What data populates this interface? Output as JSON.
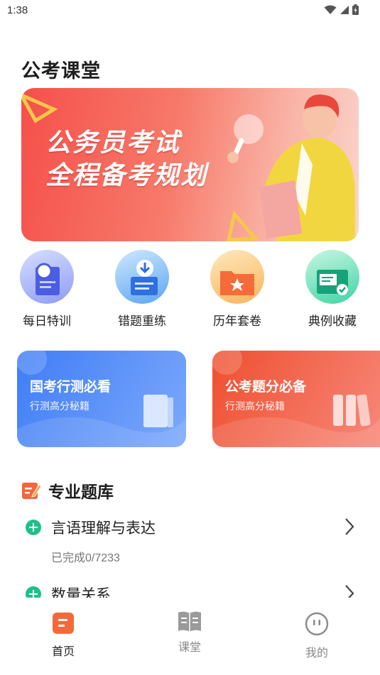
{
  "status_bar": {
    "time": "1:38"
  },
  "app_title": "公考课堂",
  "banner": {
    "line1": "公务员考试",
    "line2": "全程备考规划"
  },
  "quick_entries": [
    {
      "label": "每日特训",
      "icon": "daily-training-icon"
    },
    {
      "label": "错题重练",
      "icon": "wrong-questions-icon"
    },
    {
      "label": "历年套卷",
      "icon": "past-papers-icon"
    },
    {
      "label": "典例收藏",
      "icon": "favorites-icon"
    }
  ],
  "cards": [
    {
      "title": "国考行测必看",
      "subtitle": "行测高分秘籍",
      "color": "#4a86f7"
    },
    {
      "title": "公考题分必备",
      "subtitle": "行测高分秘籍",
      "color": "#f0573a"
    }
  ],
  "section": {
    "title": "专业题库",
    "icon": "edit-note-icon"
  },
  "topics": [
    {
      "name": "言语理解与表达",
      "progress": "已完成0/7233"
    },
    {
      "name": "数量关系",
      "progress": ""
    }
  ],
  "bottom_nav": [
    {
      "label": "首页",
      "icon": "home-icon",
      "active": true
    },
    {
      "label": "课堂",
      "icon": "book-icon",
      "active": false
    },
    {
      "label": "我的",
      "icon": "profile-icon",
      "active": false
    }
  ],
  "colors": {
    "accent": "#f0573a",
    "green": "#1ec08a",
    "blue": "#4a86f7"
  }
}
